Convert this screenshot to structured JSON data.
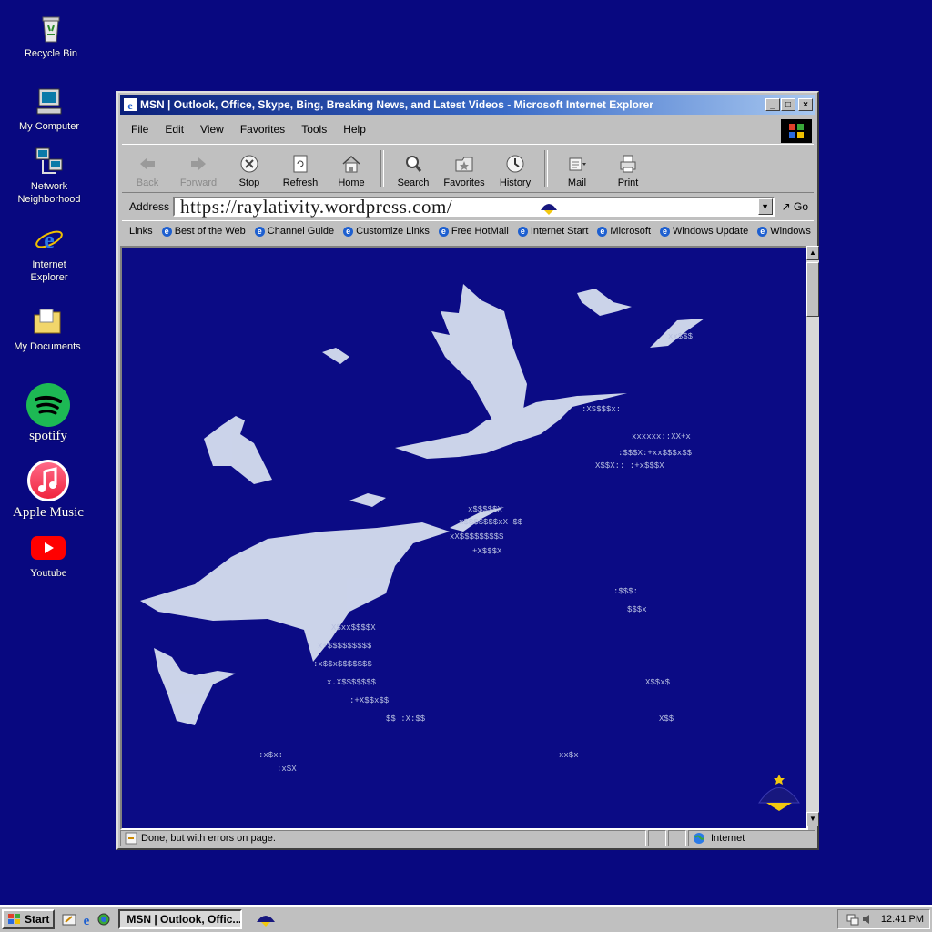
{
  "desktop": {
    "icons": [
      {
        "label": "Recycle Bin",
        "icon": "recycle-bin-icon"
      },
      {
        "label": "My Computer",
        "icon": "my-computer-icon"
      },
      {
        "label": "Network Neighborhood",
        "icon": "network-neighborhood-icon"
      },
      {
        "label": "Internet Explorer",
        "icon": "internet-explorer-icon"
      },
      {
        "label": "My Documents",
        "icon": "my-documents-icon"
      },
      {
        "label": "spotify",
        "icon": "spotify-icon"
      },
      {
        "label": "Apple Music",
        "icon": "apple-music-icon"
      },
      {
        "label": "Youtube",
        "icon": "youtube-icon"
      }
    ]
  },
  "window": {
    "title": "MSN | Outlook, Office, Skype, Bing, Breaking News, and Latest Videos - Microsoft Internet Explorer",
    "controls": {
      "minimize": "_",
      "maximize": "□",
      "close": "×"
    }
  },
  "menu": [
    "File",
    "Edit",
    "View",
    "Favorites",
    "Tools",
    "Help"
  ],
  "toolbar": [
    {
      "label": "Back",
      "icon": "back-arrow-icon",
      "enabled": false
    },
    {
      "label": "Forward",
      "icon": "forward-arrow-icon",
      "enabled": false
    },
    {
      "label": "Stop",
      "icon": "stop-icon",
      "enabled": true
    },
    {
      "label": "Refresh",
      "icon": "refresh-icon",
      "enabled": true
    },
    {
      "label": "Home",
      "icon": "home-icon",
      "enabled": true
    },
    {
      "label": "Search",
      "icon": "search-icon",
      "enabled": true
    },
    {
      "label": "Favorites",
      "icon": "favorites-icon",
      "enabled": true
    },
    {
      "label": "History",
      "icon": "history-icon",
      "enabled": true
    },
    {
      "label": "Mail",
      "icon": "mail-icon",
      "enabled": true
    },
    {
      "label": "Print",
      "icon": "print-icon",
      "enabled": true
    }
  ],
  "address": {
    "label": "Address",
    "url": "https://raylativity.wordpress.com/",
    "go_label": "Go"
  },
  "links": {
    "label": "Links",
    "items": [
      "Best of the Web",
      "Channel Guide",
      "Customize Links",
      "Free HotMail",
      "Internet Start",
      "Microsoft",
      "Windows Update",
      "Windows"
    ]
  },
  "status": {
    "text": "Done, but with errors on page.",
    "zone": "Internet"
  },
  "taskbar": {
    "start_label": "Start",
    "task_label": "MSN | Outlook, Offic...",
    "clock": "12:41 PM"
  },
  "colors": {
    "desktop": "#080880",
    "page_background": "#0b0b85",
    "bird_fill": "#d6deef",
    "ascii_color": "#b8c0e0",
    "logo_gold": "#f2c80f"
  }
}
